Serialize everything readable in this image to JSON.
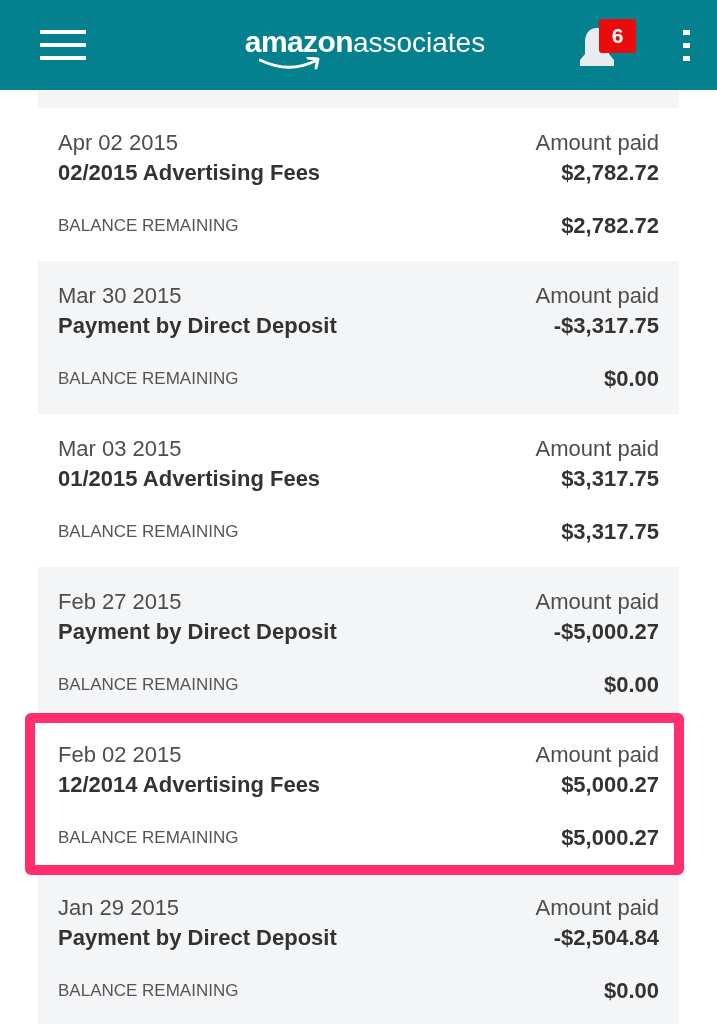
{
  "header": {
    "logo": {
      "brand": "amazon",
      "product": "associates"
    },
    "notifications": {
      "count": "6"
    }
  },
  "transactions": [
    {
      "date": "Apr 02 2015",
      "description": "02/2015 Advertising Fees",
      "amount_label": "Amount paid",
      "amount": "$2,782.72",
      "balance_label": "BALANCE REMAINING",
      "balance": "$2,782.72",
      "shaded": false,
      "highlighted": false
    },
    {
      "date": "Mar 30 2015",
      "description": "Payment by Direct Deposit",
      "amount_label": "Amount paid",
      "amount": "-$3,317.75",
      "balance_label": "BALANCE REMAINING",
      "balance": "$0.00",
      "shaded": true,
      "highlighted": false
    },
    {
      "date": "Mar 03 2015",
      "description": "01/2015 Advertising Fees",
      "amount_label": "Amount paid",
      "amount": "$3,317.75",
      "balance_label": "BALANCE REMAINING",
      "balance": "$3,317.75",
      "shaded": false,
      "highlighted": false
    },
    {
      "date": "Feb 27 2015",
      "description": "Payment by Direct Deposit",
      "amount_label": "Amount paid",
      "amount": "-$5,000.27",
      "balance_label": "BALANCE REMAINING",
      "balance": "$0.00",
      "shaded": true,
      "highlighted": false
    },
    {
      "date": "Feb 02 2015",
      "description": "12/2014 Advertising Fees",
      "amount_label": "Amount paid",
      "amount": "$5,000.27",
      "balance_label": "BALANCE REMAINING",
      "balance": "$5,000.27",
      "shaded": false,
      "highlighted": true
    },
    {
      "date": "Jan 29 2015",
      "description": "Payment by Direct Deposit",
      "amount_label": "Amount paid",
      "amount": "-$2,504.84",
      "balance_label": "BALANCE REMAINING",
      "balance": "$0.00",
      "shaded": true,
      "highlighted": false
    }
  ]
}
